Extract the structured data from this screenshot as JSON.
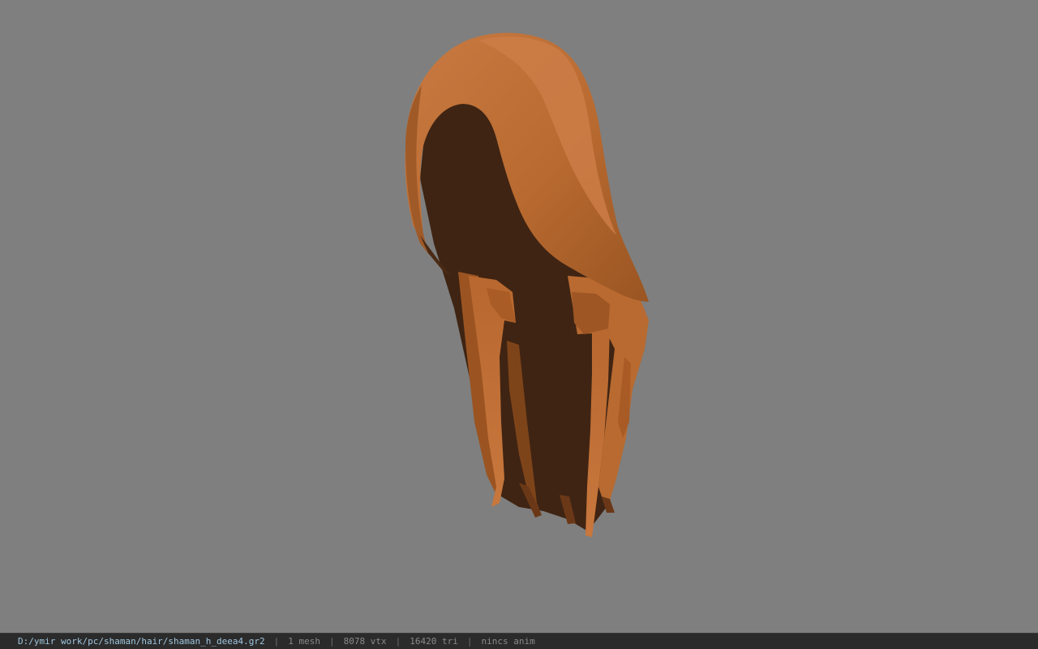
{
  "viewport": {
    "background_color": "#7f7f7f",
    "model_colors": {
      "highlight": "#c2713a",
      "mid": "#b5652c",
      "shadow": "#92501e",
      "interior": "#3e2413"
    }
  },
  "status_bar": {
    "file_path": "D:/ymir work/pc/shaman/hair/shaman_h_deea4.gr2",
    "separator": "|",
    "mesh_count": "1 mesh",
    "vertex_count": "8078 vtx",
    "triangle_count": "16420 tri",
    "anim_status": "nincs anim"
  }
}
